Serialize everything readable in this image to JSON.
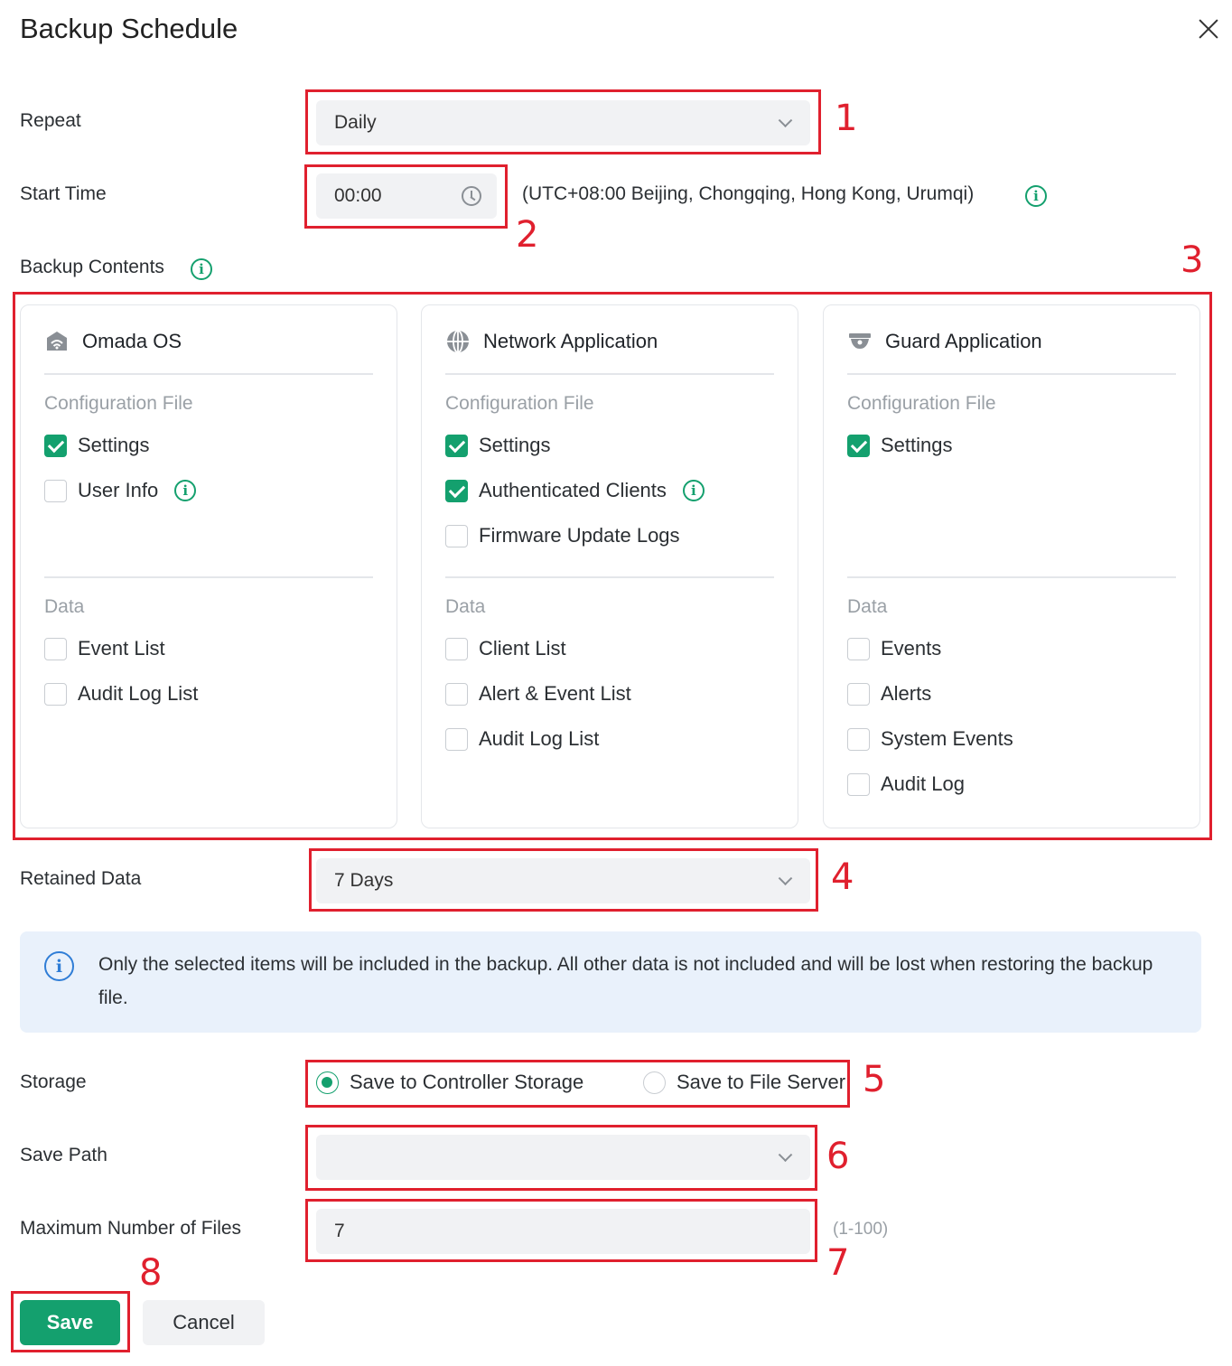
{
  "dialog": {
    "title": "Backup Schedule"
  },
  "repeat": {
    "label": "Repeat",
    "value": "Daily"
  },
  "start_time": {
    "label": "Start Time",
    "value": "00:00",
    "timezone": "(UTC+08:00 Beijing, Chongqing, Hong Kong, Urumqi)"
  },
  "backup_contents": {
    "label": "Backup Contents",
    "cards": [
      {
        "title": "Omada OS",
        "icon": "router-icon",
        "config_label": "Configuration File",
        "config_items": [
          {
            "label": "Settings",
            "checked": true
          },
          {
            "label": "User Info",
            "checked": false,
            "info": true
          }
        ],
        "data_label": "Data",
        "data_items": [
          {
            "label": "Event List",
            "checked": false
          },
          {
            "label": "Audit Log List",
            "checked": false
          }
        ]
      },
      {
        "title": "Network Application",
        "icon": "globe-icon",
        "config_label": "Configuration File",
        "config_items": [
          {
            "label": "Settings",
            "checked": true
          },
          {
            "label": "Authenticated Clients",
            "checked": true,
            "info": true
          },
          {
            "label": "Firmware Update Logs",
            "checked": false
          }
        ],
        "data_label": "Data",
        "data_items": [
          {
            "label": "Client List",
            "checked": false
          },
          {
            "label": "Alert & Event List",
            "checked": false
          },
          {
            "label": "Audit Log List",
            "checked": false
          }
        ]
      },
      {
        "title": "Guard Application",
        "icon": "camera-icon",
        "config_label": "Configuration File",
        "config_items": [
          {
            "label": "Settings",
            "checked": true
          }
        ],
        "data_label": "Data",
        "data_items": [
          {
            "label": "Events",
            "checked": false
          },
          {
            "label": "Alerts",
            "checked": false
          },
          {
            "label": "System Events",
            "checked": false
          },
          {
            "label": "Audit Log",
            "checked": false
          }
        ]
      }
    ]
  },
  "retained_data": {
    "label": "Retained Data",
    "value": "7 Days"
  },
  "notice": {
    "text": "Only the selected items will be included in the backup. All other data is not included and will be lost when restoring the backup file."
  },
  "storage": {
    "label": "Storage",
    "option_controller": "Save to Controller Storage",
    "option_file_server": "Save to File Server",
    "selected": "controller"
  },
  "save_path": {
    "label": "Save Path",
    "value": ""
  },
  "max_files": {
    "label": "Maximum Number of Files",
    "value": "7",
    "range_hint": "(1-100)"
  },
  "buttons": {
    "save": "Save",
    "cancel": "Cancel"
  },
  "annotations": [
    "1",
    "2",
    "3",
    "4",
    "5",
    "6",
    "7",
    "8"
  ],
  "colors": {
    "accent": "#14a06e",
    "annotation": "#e0202e",
    "notice_bg": "#e9f1fb",
    "info_blue": "#2f7dd6"
  }
}
